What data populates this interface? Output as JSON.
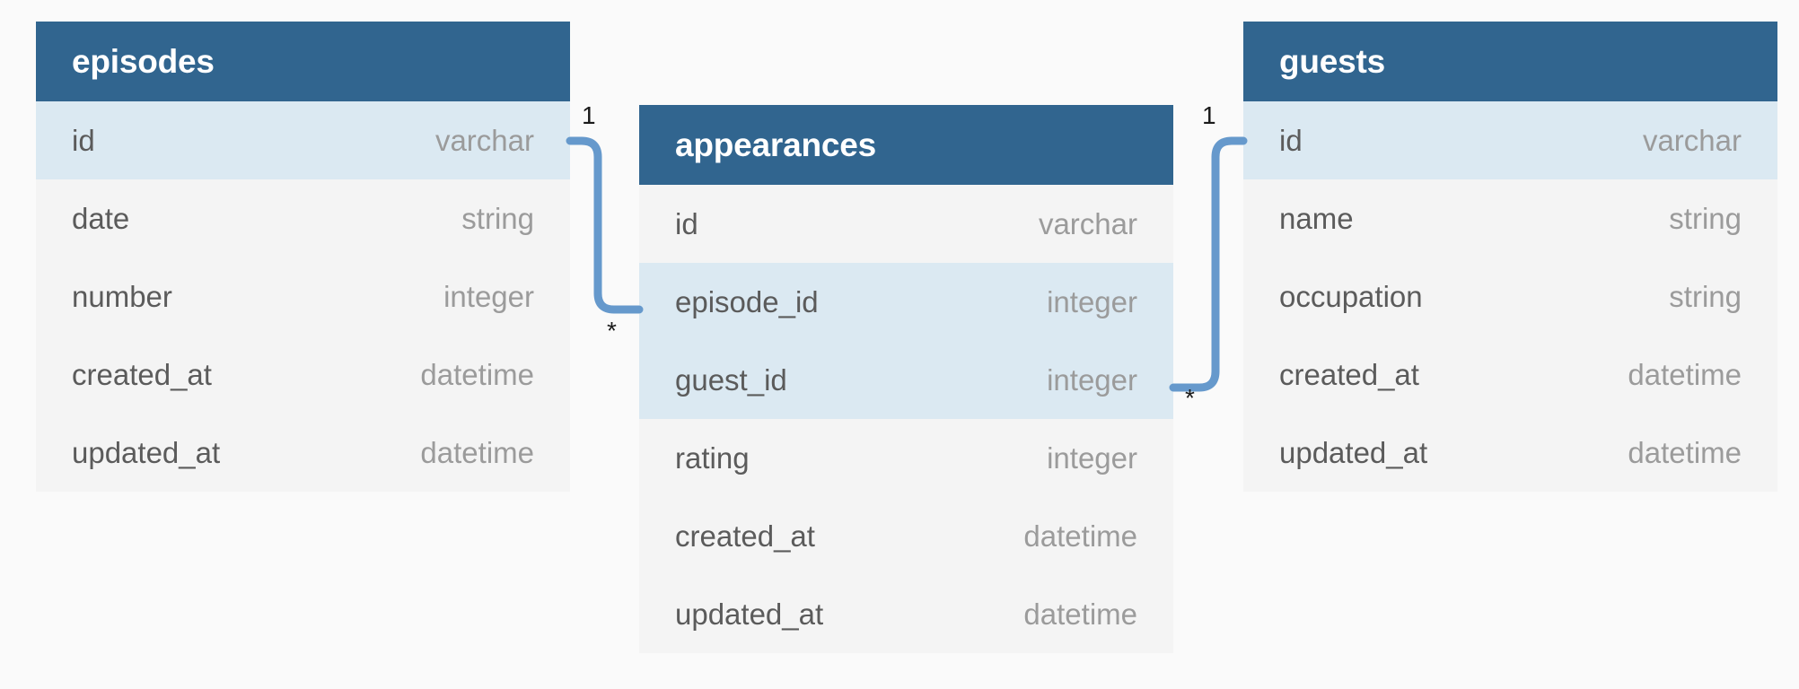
{
  "diagram": {
    "kind": "entity-relationship-diagram",
    "background_color": "#fafafa",
    "colors": {
      "header_blue": "#31658f",
      "row_background": "#f4f4f4",
      "row_highlight": "#dbe9f2",
      "field_name_text": "#5b5b5b",
      "field_type_text": "#9b9b9b",
      "connector_line": "#6699cc",
      "header_title_text": "#ffffff",
      "cardinality_text": "#1a1a1a"
    }
  },
  "entities": [
    {
      "id": "episodes",
      "title": "episodes",
      "fields": [
        {
          "name": "id",
          "type": "varchar",
          "highlight": true
        },
        {
          "name": "date",
          "type": "string",
          "highlight": false
        },
        {
          "name": "number",
          "type": "integer",
          "highlight": false
        },
        {
          "name": "created_at",
          "type": "datetime",
          "highlight": false
        },
        {
          "name": "updated_at",
          "type": "datetime",
          "highlight": false
        }
      ]
    },
    {
      "id": "appearances",
      "title": "appearances",
      "fields": [
        {
          "name": "id",
          "type": "varchar",
          "highlight": false
        },
        {
          "name": "episode_id",
          "type": "integer",
          "highlight": true
        },
        {
          "name": "guest_id",
          "type": "integer",
          "highlight": true
        },
        {
          "name": "rating",
          "type": "integer",
          "highlight": false
        },
        {
          "name": "created_at",
          "type": "datetime",
          "highlight": false
        },
        {
          "name": "updated_at",
          "type": "datetime",
          "highlight": false
        }
      ]
    },
    {
      "id": "guests",
      "title": "guests",
      "fields": [
        {
          "name": "id",
          "type": "varchar",
          "highlight": true
        },
        {
          "name": "name",
          "type": "string",
          "highlight": false
        },
        {
          "name": "occupation",
          "type": "string",
          "highlight": false
        },
        {
          "name": "created_at",
          "type": "datetime",
          "highlight": false
        },
        {
          "name": "updated_at",
          "type": "datetime",
          "highlight": false
        }
      ]
    }
  ],
  "relationships": [
    {
      "id": "episodes-appearances",
      "from_entity": "episodes",
      "from_field": "id",
      "to_entity": "appearances",
      "to_field": "episode_id",
      "from_cardinality": "1",
      "to_cardinality": "*"
    },
    {
      "id": "guests-appearances",
      "from_entity": "guests",
      "from_field": "id",
      "to_entity": "appearances",
      "to_field": "guest_id",
      "from_cardinality": "1",
      "to_cardinality": "*"
    }
  ]
}
